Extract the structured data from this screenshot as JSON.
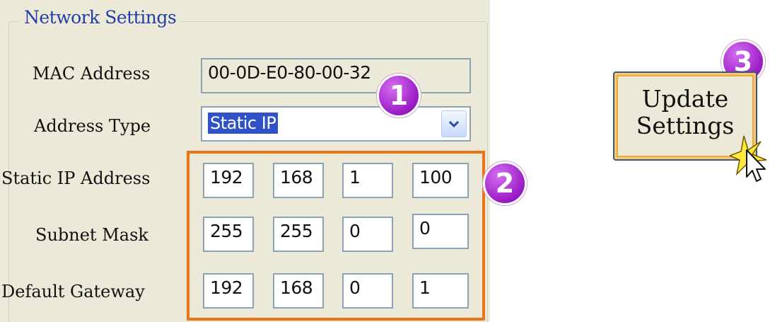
{
  "group": {
    "title": "Network Settings"
  },
  "fields": {
    "mac": {
      "label": "MAC Address",
      "value": "00-0D-E0-80-00-32"
    },
    "address_type": {
      "label": "Address Type",
      "value": "Static IP"
    },
    "static_ip": {
      "label": "Static IP Address",
      "octets": [
        "192",
        "168",
        "1",
        "100"
      ]
    },
    "subnet": {
      "label": "Subnet Mask",
      "octets": [
        "255",
        "255",
        "0",
        "0"
      ]
    },
    "gateway": {
      "label": "Default Gateway",
      "octets": [
        "192",
        "168",
        "0",
        "1"
      ]
    }
  },
  "badges": {
    "one": "1",
    "two": "2",
    "three": "3"
  },
  "update_button": {
    "line1": "Update",
    "line2": "Settings"
  },
  "colors": {
    "group_title": "#1f3fa7",
    "highlight_box": "#e8751a",
    "badge": "#9a1bc4",
    "selection": "#2f52c9"
  }
}
